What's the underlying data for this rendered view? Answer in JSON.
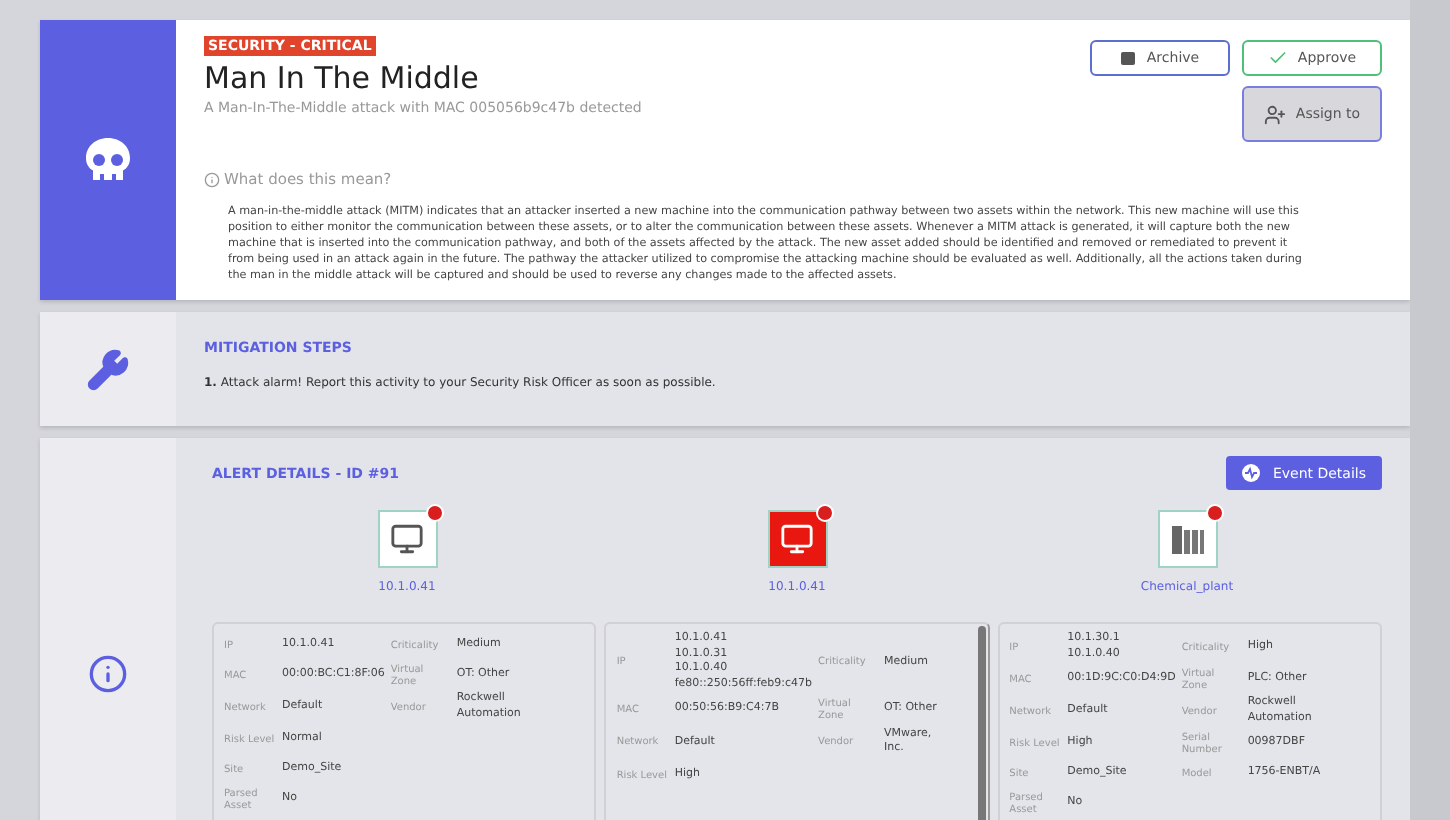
{
  "alert": {
    "badge": "SECURITY - CRITICAL",
    "title": "Man In The Middle",
    "subtitle": "A Man-In-The-Middle attack with MAC 005056b9c47b detected",
    "help_link": "What does this mean?",
    "description": "A man-in-the-middle attack (MITM) indicates that an attacker inserted a new machine into the communication pathway between two assets within the network. This new machine will use this position to either monitor the communication between these assets, or to alter the communication between these assets. Whenever a MITM attack is generated, it will capture both the new machine that is inserted into the communication pathway, and both of the assets affected by the attack. The new asset added should be identified and removed or remediated to prevent it from being used in an attack again in the future. The pathway the attacker utilized to compromise the attacking machine should be evaluated as well. Additionally, all the actions taken during the man in the middle attack will be captured and should be used to reverse any changes made to the affected assets.",
    "buttons": [
      {
        "kind": "archive",
        "label": "Archive"
      },
      {
        "kind": "approve",
        "label": "Approve"
      },
      {
        "kind": "assign",
        "label": "Assign to"
      }
    ]
  },
  "mitigation": {
    "title": "MITIGATION STEPS",
    "steps": [
      {
        "number": "1.",
        "text": "Attack alarm! Report this activity to your Security Risk Officer as soon as possible."
      }
    ]
  },
  "details": {
    "title": "ALERT DETAILS - ID #91",
    "event_button": "Event Details",
    "assets": [
      {
        "kind": "computer",
        "attacker": false,
        "label": "10.1.0.41",
        "left": [
          {
            "label": "IP",
            "values": [
              "10.1.0.41"
            ]
          },
          {
            "label": "MAC",
            "values": [
              "00:00:BC:C1:8F:06"
            ]
          },
          {
            "label": "Network",
            "values": [
              "Default"
            ]
          },
          {
            "label": "Risk Level",
            "values": [
              "Normal"
            ]
          },
          {
            "label": "Site",
            "values": [
              "Demo_Site"
            ]
          },
          {
            "label": "Parsed Asset",
            "values": [
              "No"
            ]
          }
        ],
        "right": [
          {
            "label": "Criticality",
            "values": [
              "Medium"
            ]
          },
          {
            "label": "Virtual Zone",
            "values": [
              "OT: Other"
            ]
          },
          {
            "label": "Vendor",
            "values": [
              "Rockwell",
              "Automation"
            ]
          }
        ],
        "scrollbar": false
      },
      {
        "kind": "computer",
        "attacker": true,
        "label": "10.1.0.41",
        "left": [
          {
            "label": "IP",
            "values": [
              "10.1.0.41",
              "10.1.0.31",
              "10.1.0.40",
              "fe80::250:56ff:feb9:c47b"
            ]
          },
          {
            "label": "MAC",
            "values": [
              "00:50:56:B9:C4:7B"
            ]
          },
          {
            "label": "Network",
            "values": [
              "Default"
            ]
          },
          {
            "label": "Risk Level",
            "values": [
              "High"
            ]
          }
        ],
        "right": [
          {
            "label": "Criticality",
            "values": [
              "Medium"
            ]
          },
          {
            "label": "Virtual Zone",
            "values": [
              "OT: Other"
            ]
          },
          {
            "label": "Vendor",
            "values": [
              "VMware,",
              "Inc."
            ]
          }
        ],
        "scrollbar": true
      },
      {
        "kind": "plc",
        "attacker": false,
        "label": "Chemical_plant",
        "left": [
          {
            "label": "IP",
            "values": [
              "10.1.30.1",
              "10.1.0.40"
            ]
          },
          {
            "label": "MAC",
            "values": [
              "00:1D:9C:C0:D4:9D"
            ]
          },
          {
            "label": "Network",
            "values": [
              "Default"
            ]
          },
          {
            "label": "Risk Level",
            "values": [
              "High"
            ]
          },
          {
            "label": "Site",
            "values": [
              "Demo_Site"
            ]
          },
          {
            "label": "Parsed Asset",
            "values": [
              "No"
            ]
          }
        ],
        "right": [
          {
            "label": "Criticality",
            "values": [
              "High"
            ]
          },
          {
            "label": "Virtual Zone",
            "values": [
              "PLC: Other"
            ]
          },
          {
            "label": "Vendor",
            "values": [
              "Rockwell",
              "Automation"
            ]
          },
          {
            "label": "Serial Number",
            "values": [
              "00987DBF"
            ]
          },
          {
            "label": "Model",
            "values": [
              "1756-ENBT/A"
            ]
          }
        ],
        "scrollbar": false
      }
    ]
  }
}
